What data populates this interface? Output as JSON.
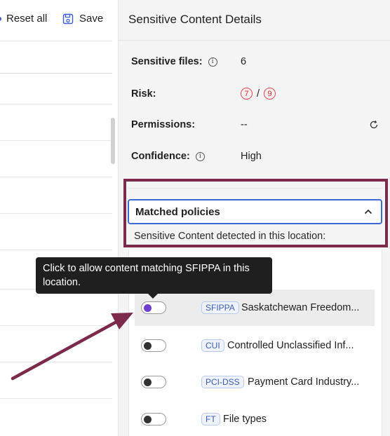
{
  "toolbar": {
    "reset_label": "Reset all",
    "save_label": "Save"
  },
  "panel": {
    "title": "Sensitive Content Details",
    "fields": {
      "sensitive_files_label": "Sensitive files:",
      "sensitive_files_value": "6",
      "risk_label": "Risk:",
      "risk_current": "7",
      "risk_sep": "/",
      "risk_max": "9",
      "permissions_label": "Permissions:",
      "permissions_value": "--",
      "confidence_label": "Confidence:",
      "confidence_value": "High"
    },
    "matched_policies": {
      "title": "Matched policies",
      "detected_text": "Sensitive Content detected in this location:"
    },
    "policies": [
      {
        "tag": "SFIPPA",
        "name": "Saskatchewan Freedom...",
        "enabled": false,
        "selected": true
      },
      {
        "tag": "CUI",
        "name": "Controlled Unclassified Inf...",
        "enabled": false,
        "selected": false
      },
      {
        "tag": "PCI-DSS",
        "name": "Payment Card Industry...",
        "enabled": false,
        "selected": false
      },
      {
        "tag": "FT",
        "name": "File types",
        "enabled": false,
        "selected": false
      }
    ]
  },
  "tooltip": {
    "text": "Click to allow content matching SFIPPA in this location."
  },
  "colors": {
    "highlight_frame": "#7c2a4c",
    "annotation_arrow": "#7c2a4c",
    "accent_blue": "#3d6bd6",
    "risk_red": "#c4282d",
    "toggle_selected_knob": "#6e3fcf"
  },
  "icons": {
    "save": "floppy-disk-icon",
    "info": "info-circle-icon",
    "refresh": "refresh-icon",
    "chevron": "chevron-up-icon"
  }
}
